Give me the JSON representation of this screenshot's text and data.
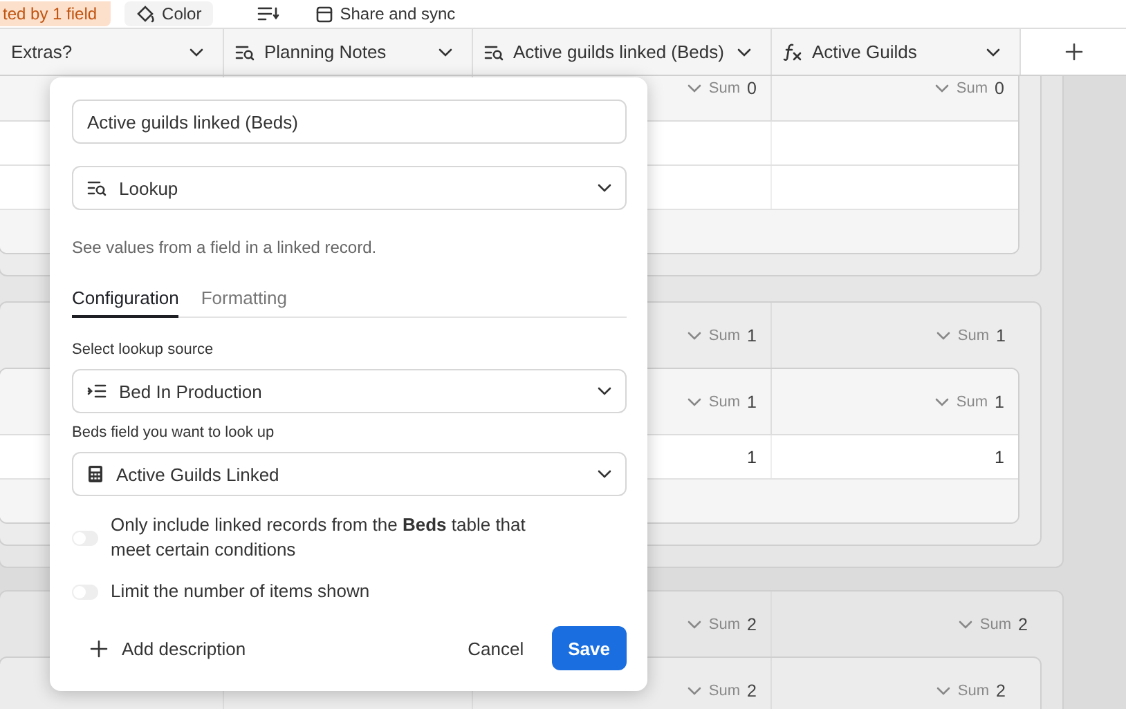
{
  "toolbar": {
    "items": [
      {
        "kind": "badge",
        "label": "ted by 1 field"
      },
      {
        "kind": "color",
        "label": "Color"
      },
      {
        "kind": "row-height"
      },
      {
        "kind": "share",
        "label": "Share and sync"
      }
    ]
  },
  "columns": [
    {
      "kind": "clipped",
      "label": "Extras?"
    },
    {
      "kind": "lookup",
      "label": "Planning Notes"
    },
    {
      "kind": "lookup",
      "label": "Active guilds linked (Beds)"
    },
    {
      "kind": "formula",
      "label": "Active Guilds"
    }
  ],
  "groups": [
    {
      "children": [
        {
          "children": [
            {
              "summary": [
                {
                  "label": "Sum",
                  "value": "0"
                },
                {
                  "label": "Sum",
                  "value": "0"
                }
              ],
              "rows": [
                {
                  "kind": "empty"
                },
                {
                  "kind": "empty"
                }
              ]
            }
          ]
        },
        {
          "summary": [
            {
              "label": "Sum",
              "value": "1"
            },
            {
              "label": "Sum",
              "value": "1"
            }
          ],
          "children": [
            {
              "summary": [
                {
                  "label": "Sum",
                  "value": "1"
                },
                {
                  "label": "Sum",
                  "value": "1"
                }
              ],
              "rows": [
                {
                  "kind": "values",
                  "values": [
                    "1",
                    "1"
                  ]
                }
              ]
            }
          ]
        }
      ]
    },
    {
      "summary": [
        {
          "label": "Sum",
          "value": "2"
        },
        {
          "label": "Sum",
          "value": "2"
        }
      ],
      "children": [
        {
          "summary": [
            {
              "label": "Sum",
              "value": "2"
            },
            {
              "label": "Sum",
              "value": "2"
            }
          ]
        }
      ]
    }
  ],
  "dialog": {
    "name": "Active guilds linked (Beds)",
    "field_type": "Lookup",
    "description": "See values from a field in a linked record.",
    "tabs": [
      {
        "label": "Configuration",
        "selected": true
      },
      {
        "label": "Formatting",
        "selected": false
      }
    ],
    "fields": [
      {
        "label": "Select lookup source",
        "value": "Bed In Production",
        "kind": "link"
      },
      {
        "label": "Beds field you want to look up",
        "value": "Active Guilds Linked",
        "kind": "calculator"
      }
    ],
    "toggles": [
      {
        "label": "Only include linked records from the **Beds** table that meet certain conditions",
        "on": false
      },
      {
        "label": "Limit the number of items shown",
        "on": false
      }
    ],
    "add_description": "Add description",
    "cancel": "Cancel",
    "save": "Save"
  }
}
